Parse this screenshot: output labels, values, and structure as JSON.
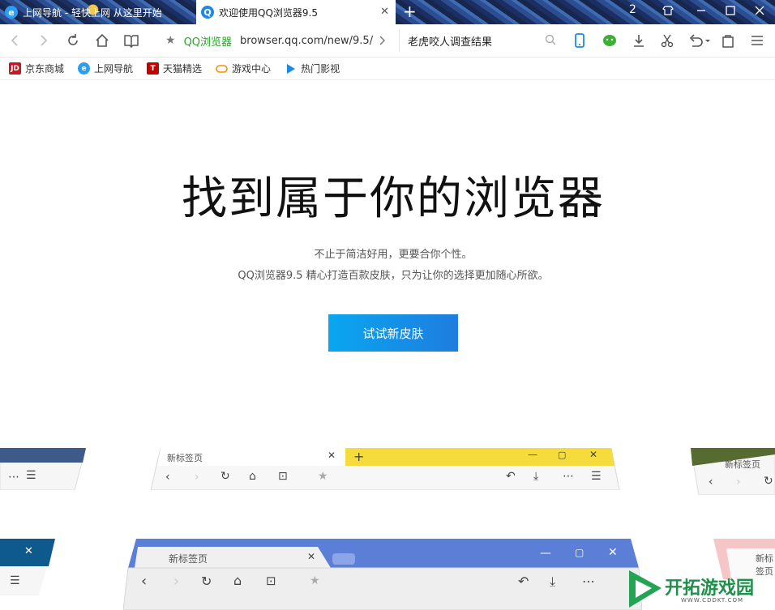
{
  "titlebar": {
    "tab1": {
      "title": "上网导航 - 轻快上网 从这里开始",
      "icon": "ie-e-icon"
    },
    "tab2": {
      "title": "欢迎使用QQ浏览器9.5",
      "icon": "qq-browser-icon",
      "close": "✕"
    },
    "new_tab": "+",
    "badge": "2"
  },
  "navbar": {
    "site_name": "QQ浏览器",
    "url": "browser.qq.com/new/9.5/",
    "search_text": "老虎咬人调查结果"
  },
  "bookmarks": [
    {
      "label": "京东商城",
      "icon": "jd-icon",
      "mark": "JD",
      "color": "#c91623"
    },
    {
      "label": "上网导航",
      "icon": "ie-e-icon",
      "mark": "e",
      "color": "#2a9df4"
    },
    {
      "label": "天猫精选",
      "icon": "tmall-icon",
      "mark": "T",
      "color": "#c40000"
    },
    {
      "label": "游戏中心",
      "icon": "gamepad-icon",
      "mark": "🎮",
      "color": "#ff8a00"
    },
    {
      "label": "热门影视",
      "icon": "play-icon",
      "mark": "▶",
      "color": "#1e88e5"
    }
  ],
  "hero": {
    "title": "找到属于你的浏览器",
    "line1": "不止于简洁好用，更要合你个性。",
    "line2": "QQ浏览器9.5 精心打造百款皮肤，只为让你的选择更加随心所欲。",
    "button": "试试新皮肤"
  },
  "previews": {
    "tab_label": "新标签页",
    "new_tab": "+",
    "close": "✕"
  },
  "colors": {
    "accent": "#1e88e5",
    "button_start": "#0aa6f0",
    "button_end": "#1e7ddf",
    "site_green": "#2da12d",
    "preview_yellow": "#f5dc3c",
    "preview_blue": "#5b7fd6"
  },
  "watermark": {
    "name": "开拓游戏园",
    "url": "WWW.CDDKT.COM"
  }
}
